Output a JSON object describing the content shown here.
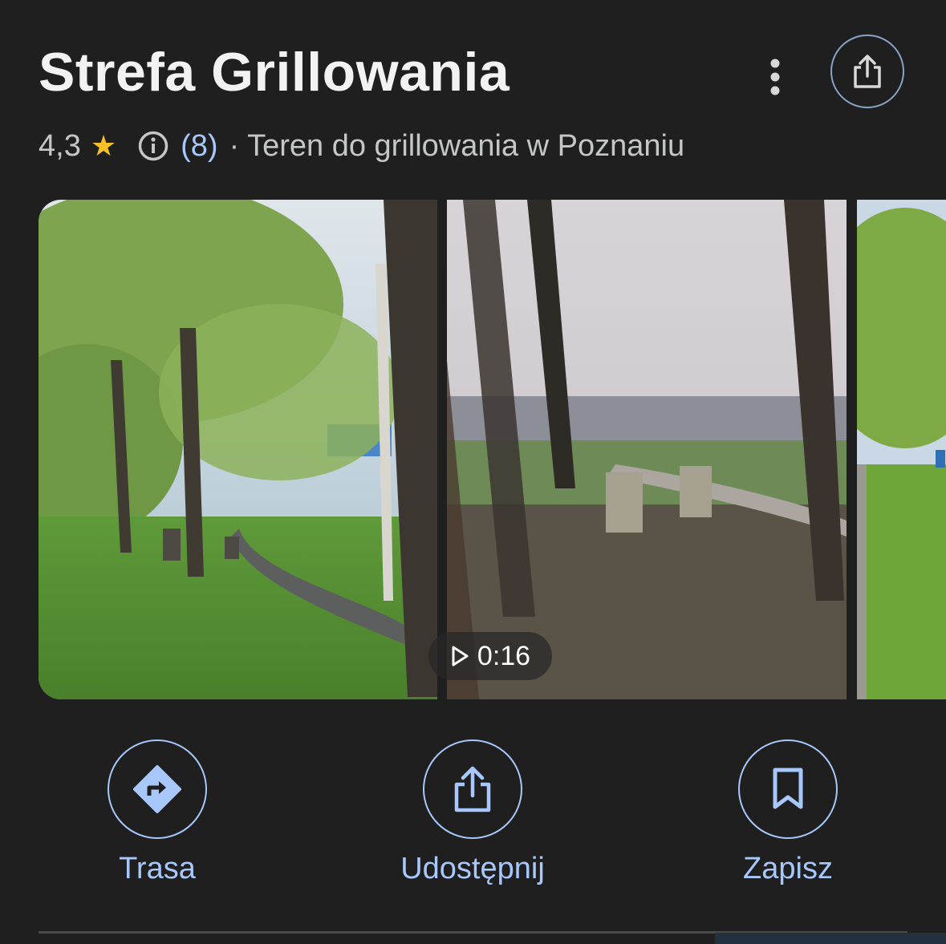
{
  "place": {
    "title": "Strefa Grillowania",
    "rating": "4,3",
    "review_count": "(8)",
    "category": "· Teren do grillowania w Poznaniu"
  },
  "header_icons": [
    "more-vert-icon",
    "share-icon"
  ],
  "photos": [
    {
      "kind": "photo",
      "description_icon": "park-photo"
    },
    {
      "kind": "video",
      "duration": "0:16"
    },
    {
      "kind": "photo",
      "description_icon": "park-photo"
    }
  ],
  "actions": [
    {
      "label": "Trasa",
      "icon": "directions-icon"
    },
    {
      "label": "Udostępnij",
      "icon": "share-icon"
    },
    {
      "label": "Zapisz",
      "icon": "bookmark-icon"
    }
  ],
  "colors": {
    "background": "#1f1f1f",
    "accent": "#a8c7fa",
    "star": "#f6c026"
  }
}
